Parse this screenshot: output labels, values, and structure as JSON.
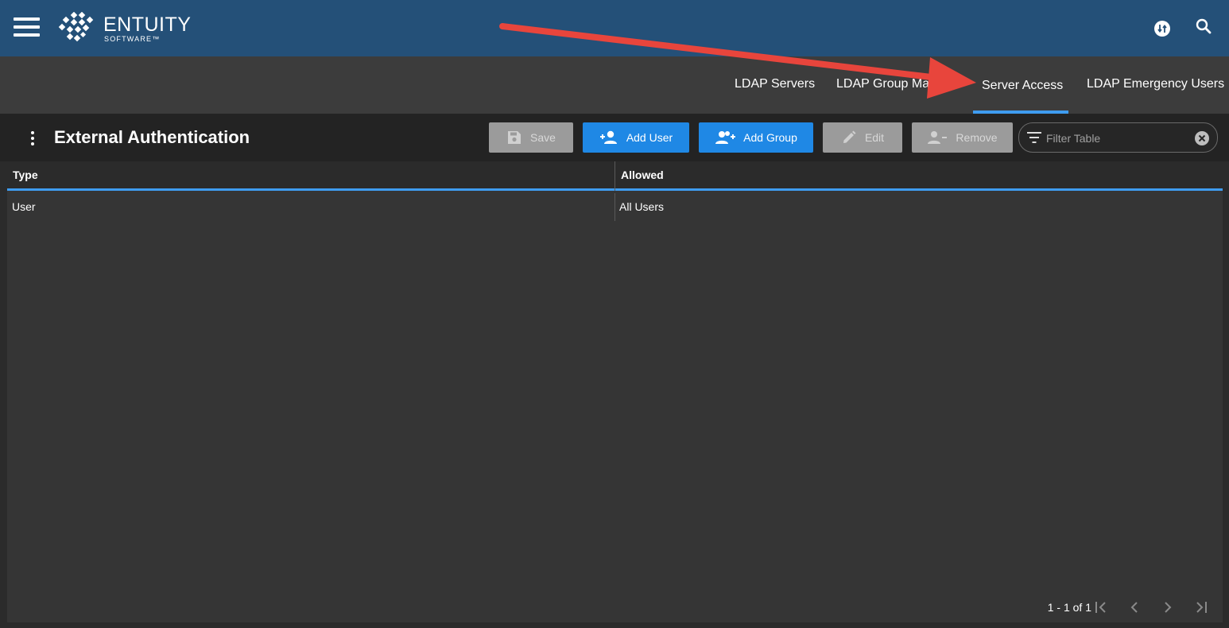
{
  "header": {
    "brand_name": "ENTUITY",
    "brand_sub": "SOFTWARE™"
  },
  "tabs": [
    {
      "label": "LDAP Servers"
    },
    {
      "label": "LDAP Group Mapping"
    },
    {
      "label": "Server Access",
      "active": true
    },
    {
      "label": "LDAP Emergency Users"
    }
  ],
  "toolbar": {
    "title": "External Authentication",
    "save_label": "Save",
    "add_user_label": "Add User",
    "add_group_label": "Add Group",
    "edit_label": "Edit",
    "remove_label": "Remove",
    "filter_placeholder": "Filter Table"
  },
  "table": {
    "columns": [
      "Type",
      "Allowed"
    ],
    "rows": [
      [
        "User",
        "All Users"
      ]
    ]
  },
  "pagination": {
    "label": "1 - 1 of 1"
  },
  "colors": {
    "header_bg": "#245078",
    "accent": "#3f9cf0",
    "primary_button": "#1f88e5",
    "annotation_arrow": "#e8453c"
  }
}
